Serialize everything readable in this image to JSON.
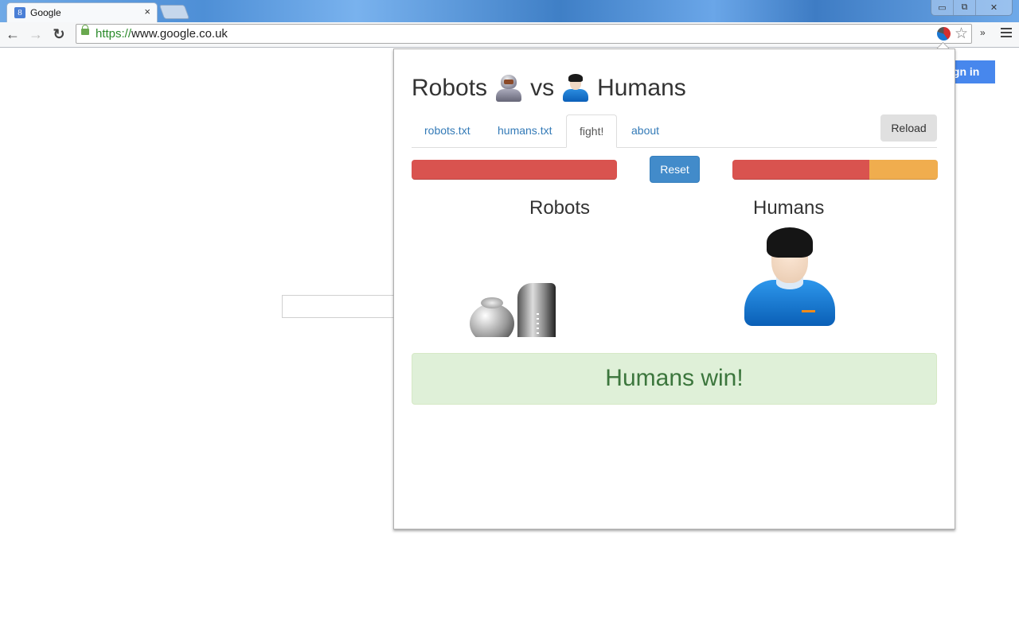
{
  "browser": {
    "tab_title": "Google",
    "tab_favicon": "8",
    "tab_close": "×",
    "window_controls": {
      "minimize": "▭",
      "restore": "⧉",
      "close": "✕"
    },
    "nav": {
      "back": "←",
      "forward": "→",
      "reload": "↻"
    },
    "url_scheme": "https://",
    "url_rest": "www.google.co.uk",
    "bookmark_star": "☆",
    "overflow": "»"
  },
  "google_page": {
    "signin_label": "ign in"
  },
  "popup": {
    "title_left": "Robots",
    "title_vs": "vs",
    "title_right": "Humans",
    "tabs": [
      {
        "label": "robots.txt",
        "active": false
      },
      {
        "label": "humans.txt",
        "active": false
      },
      {
        "label": "fight!",
        "active": true
      },
      {
        "label": "about",
        "active": false
      }
    ],
    "reload_label": "Reload",
    "reset_label": "Reset",
    "robots": {
      "label": "Robots",
      "health_segments": [
        {
          "percent": 100,
          "color": "#d9534f"
        }
      ]
    },
    "humans": {
      "label": "Humans",
      "health_segments": [
        {
          "percent": 66.5,
          "color": "#d9534f"
        },
        {
          "percent": 33.5,
          "color": "#f0ad4e"
        }
      ]
    },
    "result": "Humans win!"
  }
}
